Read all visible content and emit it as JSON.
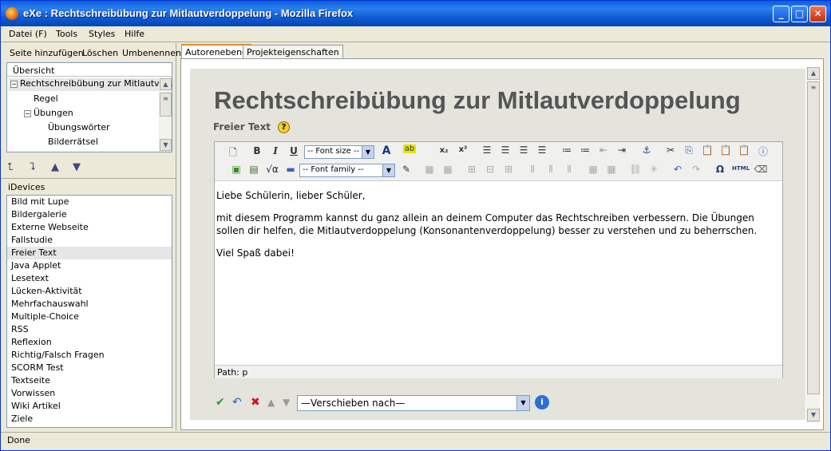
{
  "window": {
    "title": "eXe : Rechtschreibübung zur Mitlautverdoppelung - Mozilla Firefox"
  },
  "menu": [
    "Datei (F)",
    "Tools",
    "Styles",
    "Hilfe"
  ],
  "outline_actions": [
    "Seite hinzufügen",
    "Löschen",
    "Umbenennen"
  ],
  "outline": {
    "header": "Übersicht",
    "nodes": [
      "Rechtschreibübung zur Mitlautve...",
      "Regel",
      "Übungen",
      "Übungswörter",
      "Bilderrätsel"
    ]
  },
  "idevices": {
    "header": "iDevices",
    "items": [
      "Bild mit Lupe",
      "Bildergalerie",
      "Externe Webseite",
      "Fallstudie",
      "Freier Text",
      "Java Applet",
      "Lesetext",
      "Lücken-Aktivität",
      "Mehrfachauswahl",
      "Multiple-Choice",
      "RSS",
      "Reflexion",
      "Richtig/Falsch Fragen",
      "SCORM Test",
      "Textseite",
      "Vorwissen",
      "Wiki Artikel",
      "Ziele"
    ],
    "selected": "Freier Text"
  },
  "tabs": [
    "Autorenebene",
    "Projekteigenschaften"
  ],
  "page": {
    "title": "Rechtschreibübung zur Mitlautverdoppelung",
    "idevice_title": "Freier Text"
  },
  "editor": {
    "font_size_placeholder": "-- Font size --",
    "font_family_placeholder": "-- Font family --",
    "para1": "Liebe Schülerin, lieber Schüler,",
    "para2": "mit diesem Programm kannst du ganz allein an deinem Computer das Rechtschreiben verbessern. Die Übungen sollen dir helfen, die Mitlautverdoppelung (Konsonantenverdoppelung) besser zu verstehen und zu beherrschen.",
    "para3": "Viel Spaß dabei!",
    "path": "Path: p"
  },
  "move_to": "—Verschieben nach—",
  "status": "Done"
}
